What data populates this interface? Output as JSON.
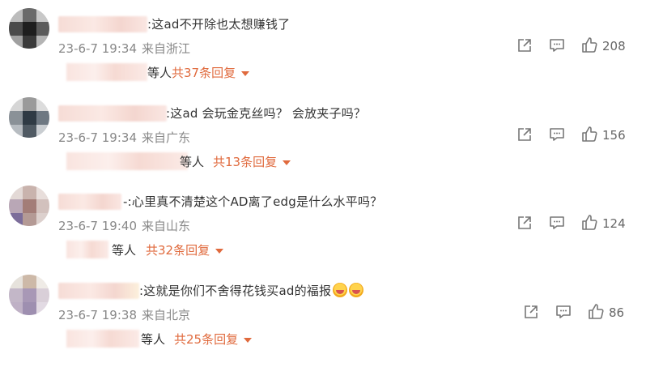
{
  "comments": [
    {
      "text": ":这ad不开除也太想赚钱了",
      "date": "23-6-7 19:34",
      "location": "来自浙江",
      "likes": "208",
      "replies_tail": "等人",
      "replies_total": "共37条回复"
    },
    {
      "text": ":这ad 会玩金克丝吗？  会放夹子吗？",
      "date": "23-6-7 19:34",
      "location": "来自广东",
      "likes": "156",
      "replies_tail": "等人",
      "replies_total": "共13条回复"
    },
    {
      "text": "-:心里真不清楚这个AD离了edg是什么水平吗？",
      "date": "23-6-7 19:40",
      "location": "来自山东",
      "likes": "124",
      "replies_tail": "等人",
      "replies_total": "共32条回复"
    },
    {
      "text": ":这就是你们不舍得花钱买ad的福报",
      "date": "23-6-7 19:38",
      "location": "来自北京",
      "likes": "86",
      "replies_tail": "等人",
      "replies_total": "共25条回复"
    }
  ],
  "icons": {
    "share": "share-icon",
    "comment": "comment-icon",
    "like": "thumbs-up-icon",
    "emoji": "crying-face-emoji-icon"
  },
  "colors": {
    "reply_accent": "#e06a3d",
    "meta_gray": "#888888"
  }
}
